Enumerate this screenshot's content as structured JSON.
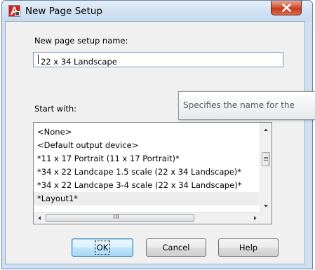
{
  "window": {
    "title": "New Page Setup"
  },
  "labels": {
    "name_label": "New page setup name:",
    "start_label": "Start with:"
  },
  "name_input": {
    "value": "22 x 34 Landscape"
  },
  "tooltip": {
    "text": "Specifies the name for the"
  },
  "start_list": {
    "items": [
      "<None>",
      "<Default output device>",
      "*11 x 17 Portrait (11 x 17 Portrait)*",
      "*34 x 22 Landcape 1.5 scale (22 x 34 Landscape)*",
      "*34 x 22 Landcape 3-4 scale (22 x 34 Landscape)*",
      "*Layout1*"
    ],
    "selected_index": 5,
    "scroll_grip": "III"
  },
  "buttons": {
    "ok": "OK",
    "cancel": "Cancel",
    "help": "Help"
  },
  "colors": {
    "title_bar": "#cfe0f2",
    "close_button": "#c33a1b",
    "default_button_border": "#3c7fb1"
  },
  "icons": {
    "app": "autocad-app-icon",
    "close": "close-x-icon"
  }
}
